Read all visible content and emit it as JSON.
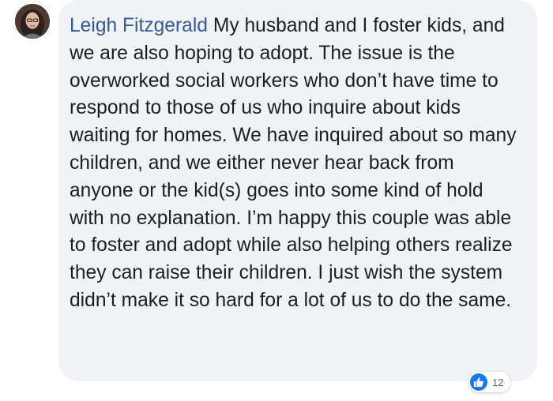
{
  "comment": {
    "author": "Leigh Fitzgerald",
    "text": "My husband and I foster kids, and we are also hoping to adopt. The issue is the overworked social workers who don’t have time to respond to those of us who inquire about kids waiting for homes. We have inquired about so many children, and we either never hear back from anyone or the kid(s) goes into some kind of hold with no explanation. I’m happy this couple was able to foster and adopt while also helping others realize they can raise their children. I just wish the system didn’t make it so hard for a lot of us to do the same."
  },
  "reactions": {
    "icon": "like-icon",
    "count": "12",
    "color": "#1877f2"
  },
  "colors": {
    "author": "#385898",
    "bubble": "#f0f2f5",
    "text": "#1c1e21"
  }
}
